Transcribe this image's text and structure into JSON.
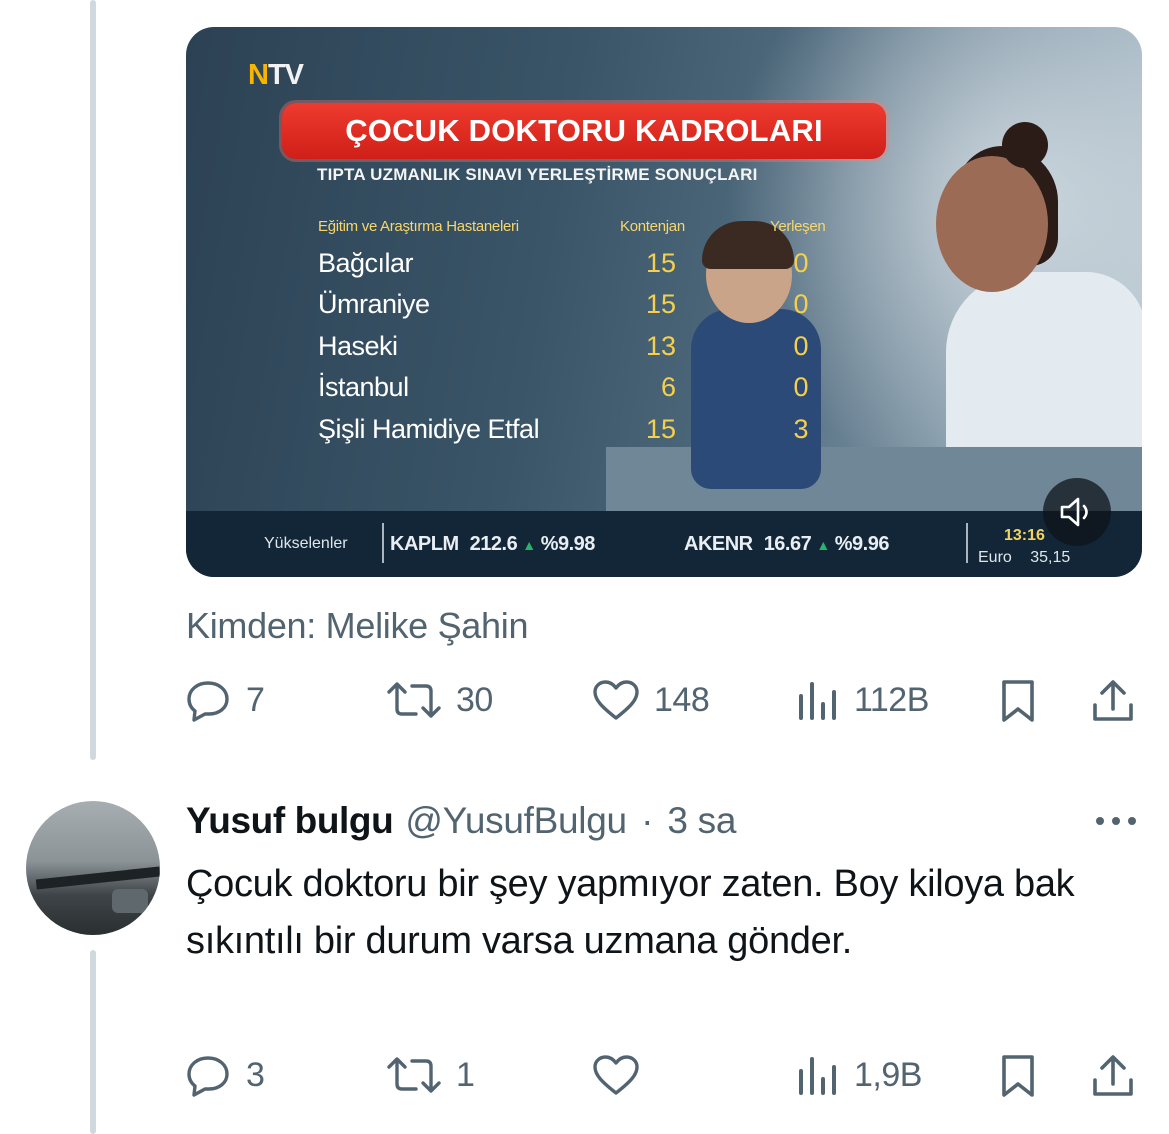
{
  "video": {
    "channel_logo": "NTV",
    "banner_title": "ÇOCUK DOKTORU KADROLARI",
    "subtitle": "TIPTA UZMANLIK SINAVI YERLEŞTİRME SONUÇLARI",
    "table": {
      "headers": [
        "Eğitim ve Araştırma Hastaneleri",
        "Kontenjan",
        "Yerleşen"
      ],
      "rows": [
        {
          "name": "Bağcılar",
          "kontenjan": "15",
          "yerlesen": "0"
        },
        {
          "name": "Ümraniye",
          "kontenjan": "15",
          "yerlesen": "0"
        },
        {
          "name": "Haseki",
          "kontenjan": "13",
          "yerlesen": "0"
        },
        {
          "name": "İstanbul",
          "kontenjan": "6",
          "yerlesen": "0"
        },
        {
          "name": "Şişli Hamidiye Etfal",
          "kontenjan": "15",
          "yerlesen": "3"
        }
      ]
    },
    "ticker": {
      "label": "Yükselenler",
      "items": [
        {
          "symbol": "KAPLM",
          "price": "212.6",
          "change": "%9.98"
        },
        {
          "symbol": "AKENR",
          "price": "16.67",
          "change": "%9.96"
        }
      ],
      "time": "13:16",
      "currency_label": "Euro",
      "currency_value": "35,15"
    },
    "volume_icon": "speaker-icon"
  },
  "source_text": "Kimden: Melike Şahin",
  "post_actions": {
    "replies": "7",
    "reposts": "30",
    "likes": "148",
    "views": "112B"
  },
  "reply": {
    "author_name": "Yusuf bulgu",
    "handle": "@YusufBulgu",
    "separator": "·",
    "time": "3 sa",
    "text": "Çocuk doktoru bir şey yapmıyor zaten. Boy kiloya bak sıkıntılı bir durum varsa uzmana gönder.",
    "actions": {
      "replies": "3",
      "reposts": "1",
      "likes": "",
      "views": "1,9B"
    }
  },
  "colors": {
    "text_primary": "#0f1419",
    "text_secondary": "#536471",
    "banner_red": "#e0291f",
    "ticker_bg": "#132637"
  }
}
